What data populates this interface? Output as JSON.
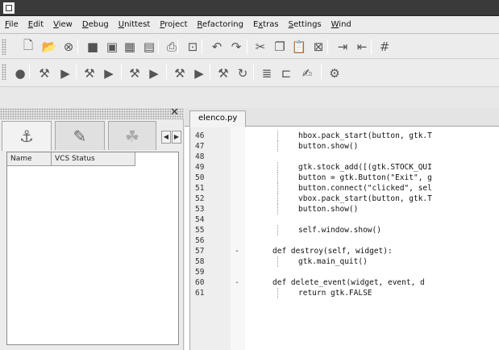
{
  "menu": [
    {
      "ul": "F",
      "rest": "ile"
    },
    {
      "ul": "E",
      "rest": "dit"
    },
    {
      "ul": "V",
      "rest": "iew"
    },
    {
      "ul": "D",
      "rest": "ebug"
    },
    {
      "ul": "U",
      "rest": "nittest"
    },
    {
      "ul": "P",
      "rest": "roject"
    },
    {
      "ul": "R",
      "rest": "efactoring"
    },
    {
      "pre": "E",
      "ul": "x",
      "rest": "tras"
    },
    {
      "ul": "S",
      "rest": "ettings"
    },
    {
      "ul": "W",
      "rest": "ind"
    }
  ],
  "toolbar1_icons": [
    "new-file-icon",
    "open-file-icon",
    "close-file-icon",
    "save-icon",
    "save-as-icon",
    "save-all-icon",
    "save-copy-icon",
    "print-icon",
    "print-preview-icon",
    "undo-icon",
    "redo-icon",
    "cut-icon",
    "copy-icon",
    "paste-icon",
    "clear-icon",
    "indent-icon",
    "unindent-icon",
    "comment-icon"
  ],
  "toolbar2_icons": [
    "breakpoint-icon",
    "debug-script-icon",
    "run-script-icon",
    "debug-project-icon",
    "run-project-icon",
    "continue-icon",
    "step-icon",
    "step-over-icon",
    "step-out-icon",
    "stop-icon",
    "restart-icon",
    "toggle-breakpoint-icon",
    "clear-breakpoints-icon",
    "profile-icon",
    "search-icon"
  ],
  "left_panel": {
    "tabs": [
      "project-viewer-icon",
      "debug-viewer-icon",
      "browser-icon"
    ],
    "columns": [
      "Name",
      "VCS Status"
    ]
  },
  "editor": {
    "tab_label": "elenco.py",
    "lines": [
      {
        "n": "46",
        "fold": "",
        "guide": true,
        "code": "hbox.pack_start(button, gtk.T"
      },
      {
        "n": "47",
        "fold": "",
        "guide": true,
        "code": "button.show()"
      },
      {
        "n": "48",
        "fold": "",
        "guide": false,
        "code": ""
      },
      {
        "n": "49",
        "fold": "",
        "guide": true,
        "code": "gtk.stock_add([(gtk.STOCK_QUI"
      },
      {
        "n": "50",
        "fold": "",
        "guide": true,
        "code": "button = gtk.Button(\"Exit\", g"
      },
      {
        "n": "51",
        "fold": "",
        "guide": true,
        "code": "button.connect(\"clicked\", sel"
      },
      {
        "n": "52",
        "fold": "",
        "guide": true,
        "code": "vbox.pack_start(button, gtk.T"
      },
      {
        "n": "53",
        "fold": "",
        "guide": true,
        "code": "button.show()"
      },
      {
        "n": "54",
        "fold": "",
        "guide": false,
        "code": ""
      },
      {
        "n": "55",
        "fold": "",
        "guide": true,
        "code": "self.window.show()"
      },
      {
        "n": "56",
        "fold": "",
        "guide": false,
        "code": ""
      },
      {
        "n": "57",
        "fold": "-",
        "guide": false,
        "def": true,
        "code": "def destroy(self, widget):"
      },
      {
        "n": "58",
        "fold": "",
        "guide": true,
        "code": "gtk.main_quit()"
      },
      {
        "n": "59",
        "fold": "",
        "guide": false,
        "code": ""
      },
      {
        "n": "60",
        "fold": "-",
        "guide": false,
        "def": true,
        "code": "def delete_event(widget, event, d"
      },
      {
        "n": "61",
        "fold": "",
        "guide": true,
        "code": "return gtk.FALSE"
      }
    ]
  }
}
